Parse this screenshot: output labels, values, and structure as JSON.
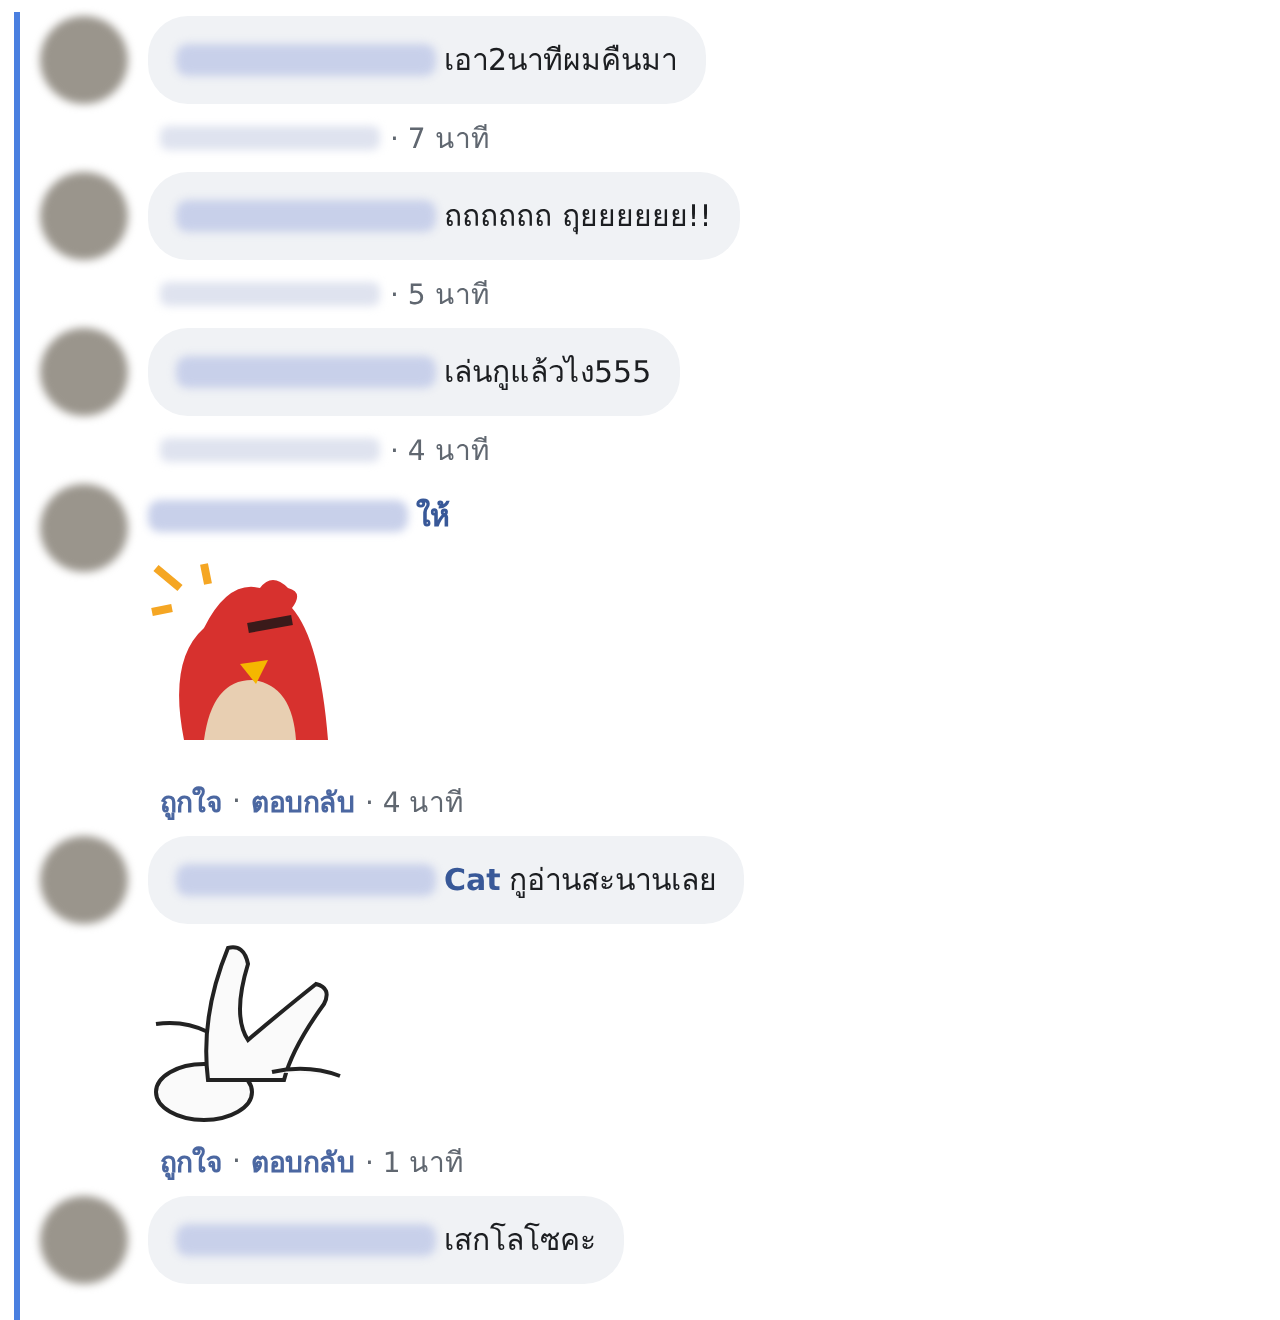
{
  "comments": [
    {
      "kind": "text",
      "text": "เอา2นาทีผมคืนมา",
      "meta": [
        {
          "kind": "blurred"
        },
        {
          "kind": "time",
          "text": "· 7 นาที"
        }
      ]
    },
    {
      "kind": "text",
      "text": "ถถถถถถ ฤุยยยยยย!!",
      "meta": [
        {
          "kind": "blurred"
        },
        {
          "kind": "time",
          "text": "· 5 นาที"
        }
      ]
    },
    {
      "kind": "text",
      "text": "เล่นกูแล้วไง555",
      "meta": [
        {
          "kind": "blurred"
        },
        {
          "kind": "time",
          "text": "· 4 นาที"
        }
      ]
    },
    {
      "kind": "sticker",
      "sticker": {
        "kind": "bird"
      },
      "name_fragment": "ให้",
      "meta": [
        {
          "kind": "link",
          "text": "ถูกใจ"
        },
        {
          "kind": "time",
          "text": "·"
        },
        {
          "kind": "link",
          "text": "ตอบกลับ"
        },
        {
          "kind": "time",
          "text": "· 4 นาที"
        }
      ]
    },
    {
      "kind": "text_sticker",
      "sticker": {
        "kind": "creature"
      },
      "name_fragment": "Cat",
      "text": "กูอ่านสะนานเลย",
      "meta": [
        {
          "kind": "link",
          "text": "ถูกใจ"
        },
        {
          "kind": "time",
          "text": "·"
        },
        {
          "kind": "link",
          "text": "ตอบกลับ"
        },
        {
          "kind": "time",
          "text": "· 1 นาที"
        }
      ]
    },
    {
      "kind": "text",
      "text": "เสกโลโซคะ"
    }
  ]
}
